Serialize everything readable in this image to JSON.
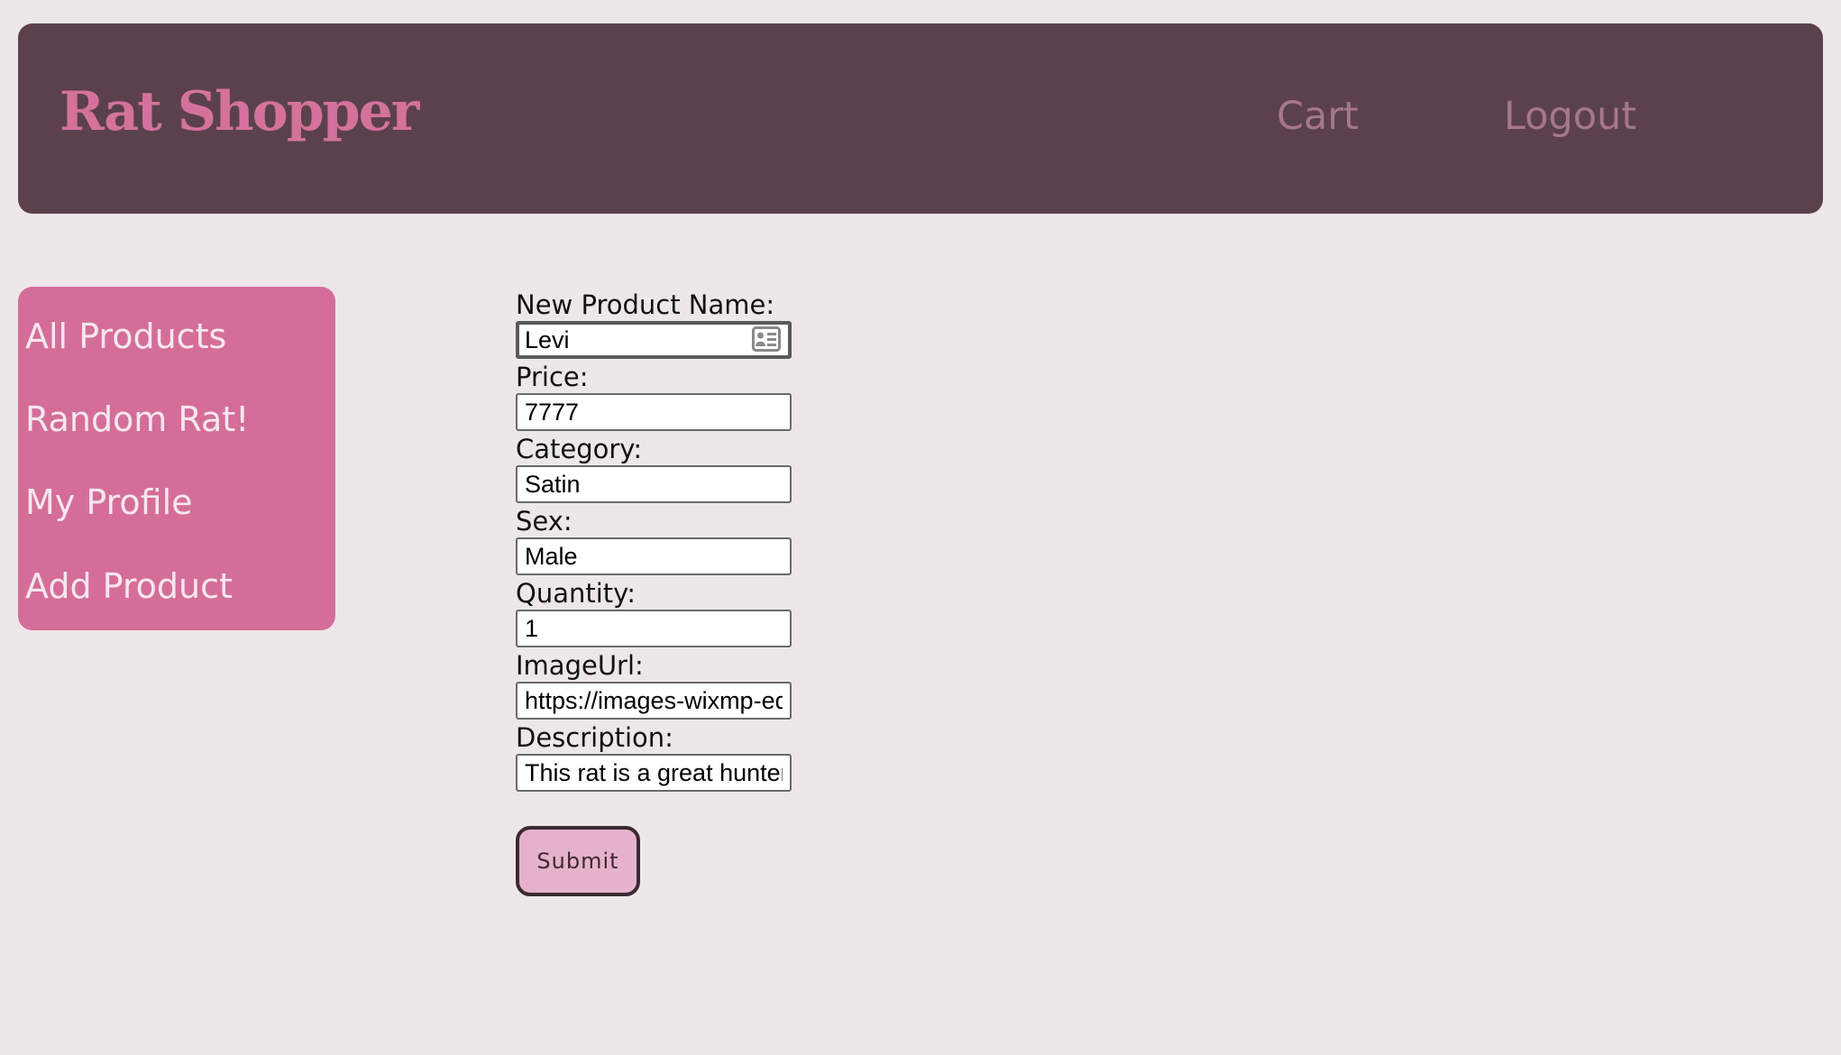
{
  "header": {
    "brand": "Rat Shopper",
    "nav": {
      "cart": "Cart",
      "logout": "Logout"
    }
  },
  "sidebar": {
    "items": [
      {
        "label": "All Products"
      },
      {
        "label": "Random Rat!"
      },
      {
        "label": "My Profile"
      },
      {
        "label": "Add Product"
      }
    ]
  },
  "form": {
    "fields": [
      {
        "label": "New Product Name:",
        "value": "Levi"
      },
      {
        "label": "Price:",
        "value": "7777"
      },
      {
        "label": "Category:",
        "value": "Satin"
      },
      {
        "label": "Sex:",
        "value": "Male"
      },
      {
        "label": "Quantity:",
        "value": "1"
      },
      {
        "label": "ImageUrl:",
        "value": "https://images-wixmp-ed"
      },
      {
        "label": "Description:",
        "value": "This rat is a great hunter"
      }
    ],
    "submit_label": "Submit"
  },
  "icons": {
    "autofill": "contact-card-icon"
  },
  "colors": {
    "page_bg": "#ede7e9",
    "header_bg": "#5b414c",
    "brand": "#d4729b",
    "nav_link": "#a6778c",
    "sidebar_bg": "#d46e99",
    "sidebar_text": "#f6e7ee",
    "submit_bg": "#e6b2cb"
  }
}
